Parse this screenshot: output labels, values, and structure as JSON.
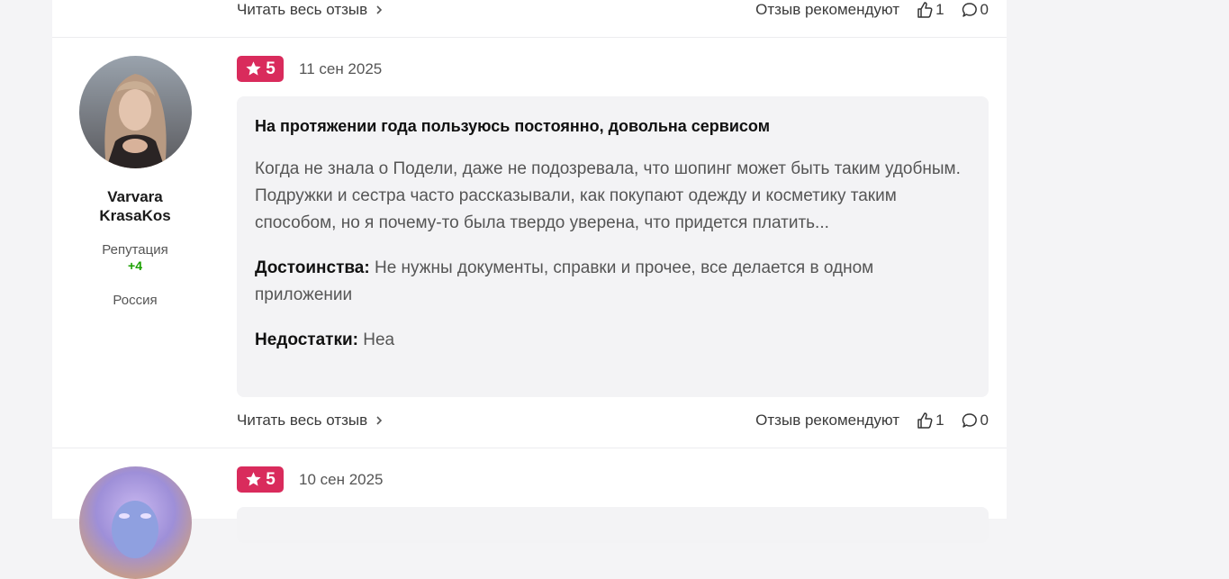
{
  "prev_review": {
    "read_full": "Читать весь отзыв",
    "recommend_text": "Отзыв рекомендуют",
    "likes": "1",
    "comments": "0"
  },
  "review": {
    "author_first": "Varvara",
    "author_last": "KrasaKos",
    "reputation_label": "Репутация",
    "reputation_value": "+4",
    "country": "Россия",
    "rating": "5",
    "date": "11 сен 2025",
    "title": "На протяжении года пользуюсь постоянно, довольна сервисом",
    "text": "Когда не знала о Подели, даже не подозревала, что шопинг может быть таким удобным. Подружки и сестра часто рассказывали, как покупают одежду и косметику таким способом, но я почему-то была твердо уверена, что придется платить...",
    "pros_label": "Достоинства:",
    "pros": "Не нужны документы, справки и прочее, все делается в одном приложении",
    "cons_label": "Недостатки:",
    "cons": "Неа",
    "read_full": "Читать весь отзыв",
    "recommend_text": "Отзыв рекомендуют",
    "likes": "1",
    "comments": "0"
  },
  "next_review": {
    "rating": "5",
    "date": "10 сен 2025"
  },
  "colors": {
    "badge": "#d92b5c",
    "reputation": "#1aa000",
    "review_bg": "#f3f3f5"
  }
}
